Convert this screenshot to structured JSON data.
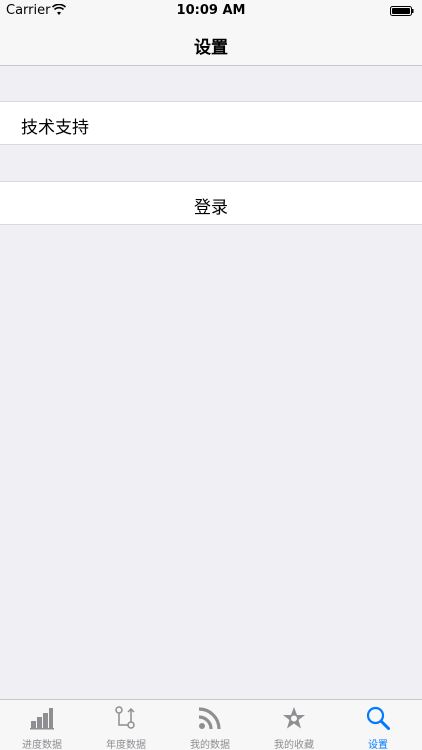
{
  "status_bar": {
    "carrier": "Carrier",
    "time": "10:09 AM"
  },
  "nav": {
    "title": "设置"
  },
  "cells": {
    "support": "技术支持",
    "login": "登录"
  },
  "tabs": [
    {
      "label": "进度数据",
      "icon": "bar-chart-icon"
    },
    {
      "label": "年度数据",
      "icon": "compare-arrows-icon"
    },
    {
      "label": "我的数据",
      "icon": "rss-feed-icon"
    },
    {
      "label": "我的收藏",
      "icon": "star-icon"
    },
    {
      "label": "设置",
      "icon": "search-icon",
      "active": true
    }
  ],
  "colors": {
    "accent": "#007aff",
    "inactive": "#8e8e93",
    "background": "#efeff4"
  }
}
